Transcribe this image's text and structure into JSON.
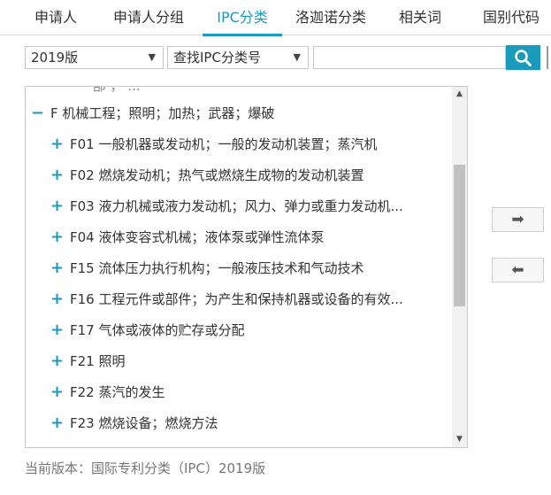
{
  "tabs": [
    {
      "label": "申请人",
      "active": false
    },
    {
      "label": "申请人分组",
      "active": false
    },
    {
      "label": "IPC分类",
      "active": true
    },
    {
      "label": "洛迦诺分类",
      "active": false
    },
    {
      "label": "相关词",
      "active": false
    },
    {
      "label": "国别代码",
      "active": false
    }
  ],
  "toolbar": {
    "version_select": "2019版",
    "find_select": "查找IPC分类号",
    "search_value": "",
    "caret_glyph": "▼",
    "search_icon": "search-icon"
  },
  "tree": {
    "clipped_top": "一  部 ，  ...",
    "parent": {
      "toggle": "−",
      "label": "F 机械工程；照明；加热；武器；爆破"
    },
    "children": [
      {
        "toggle": "+",
        "label": "F01 一般机器或发动机；一般的发动机装置；蒸汽机"
      },
      {
        "toggle": "+",
        "label": "F02 燃烧发动机；热气或燃烧生成物的发动机装置"
      },
      {
        "toggle": "+",
        "label": "F03 液力机械或液力发动机；风力、弹力或重力发动机..."
      },
      {
        "toggle": "+",
        "label": "F04 液体变容式机械；液体泵或弹性流体泵"
      },
      {
        "toggle": "+",
        "label": "F15 流体压力执行机构；一般液压技术和气动技术"
      },
      {
        "toggle": "+",
        "label": "F16 工程元件或部件；为产生和保持机器或设备的有效..."
      },
      {
        "toggle": "+",
        "label": "F17 气体或液体的贮存或分配"
      },
      {
        "toggle": "+",
        "label": "F21 照明"
      },
      {
        "toggle": "+",
        "label": "F22 蒸汽的发生"
      },
      {
        "toggle": "+",
        "label": "F23 燃烧设备；燃烧方法"
      }
    ]
  },
  "scroll": {
    "up": "▲",
    "down": "▼"
  },
  "move": {
    "add": "➡",
    "remove": "⬅"
  },
  "footer": "当前版本：国际专利分类（IPC）2019版",
  "colors": {
    "accent": "#1a9bbd"
  }
}
